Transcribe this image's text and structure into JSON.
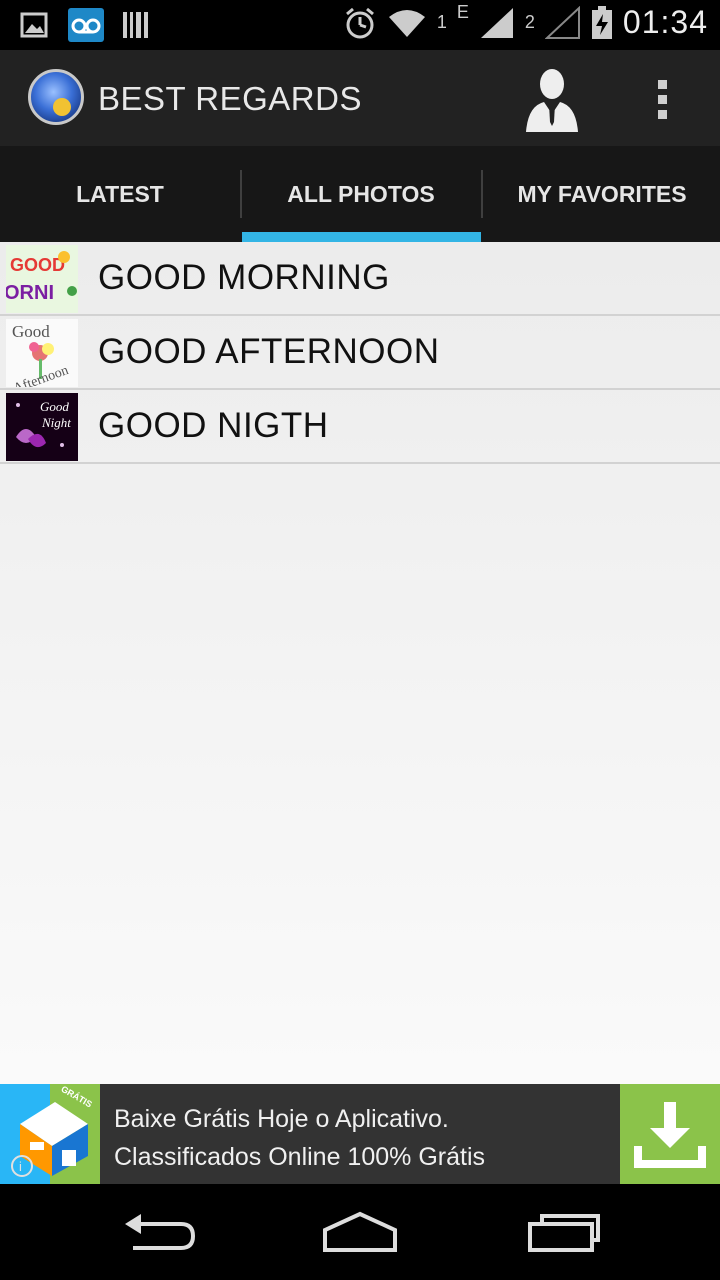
{
  "status_bar": {
    "signal1_label": "1",
    "network_type": "E",
    "signal2_label": "2",
    "time": "01:34"
  },
  "action_bar": {
    "title": "BEST REGARDS"
  },
  "tabs": [
    {
      "label": "LATEST",
      "selected": false
    },
    {
      "label": "ALL PHOTOS",
      "selected": true
    },
    {
      "label": "MY FAVORITES",
      "selected": false
    }
  ],
  "list": {
    "items": [
      {
        "label": "GOOD MORNING",
        "thumb_text": "GOOD"
      },
      {
        "label": "GOOD AFTERNOON",
        "thumb_text": "Good"
      },
      {
        "label": "GOOD NIGTH",
        "thumb_text": "Good"
      }
    ]
  },
  "ad": {
    "line1": "Baixe Grátis Hoje o Aplicativo.",
    "line2": "Classificados Online 100% Grátis",
    "badge": "GRÁTIS"
  },
  "colors": {
    "accent": "#33b5e5",
    "ad_green": "#8bc34a",
    "action_bar_bg": "#222222",
    "tab_bar_bg": "#171717"
  }
}
